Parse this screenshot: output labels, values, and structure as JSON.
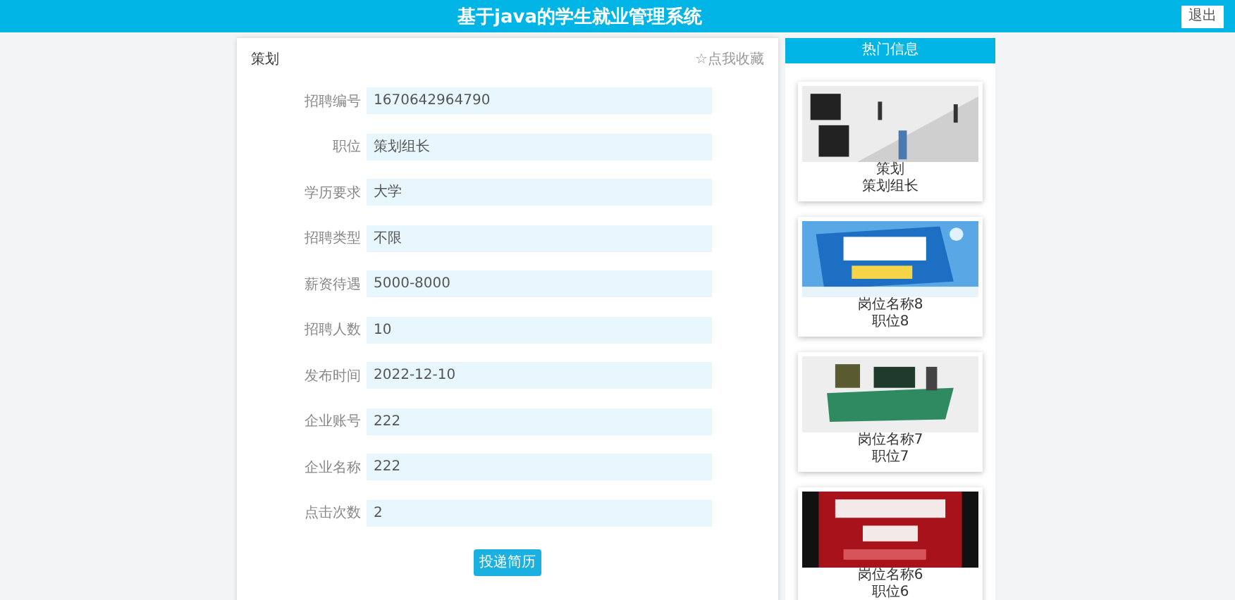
{
  "header": {
    "title": "基于java的学生就业管理系统",
    "logout": "退出"
  },
  "detail": {
    "title": "策划",
    "favorite": "☆点我收藏",
    "fields": [
      {
        "label": "招聘编号",
        "value": "1670642964790"
      },
      {
        "label": "职位",
        "value": "策划组长"
      },
      {
        "label": "学历要求",
        "value": "大学"
      },
      {
        "label": "招聘类型",
        "value": "不限"
      },
      {
        "label": "薪资待遇",
        "value": "5000-8000"
      },
      {
        "label": "招聘人数",
        "value": "10"
      },
      {
        "label": "发布时间",
        "value": "2022-12-10"
      },
      {
        "label": "企业账号",
        "value": "222"
      },
      {
        "label": "企业名称",
        "value": "222"
      },
      {
        "label": "点击次数",
        "value": "2"
      }
    ],
    "submit": "投递简历"
  },
  "sidebar": {
    "title": "热门信息",
    "cards": [
      {
        "title": "策划",
        "subtitle": "策划组长"
      },
      {
        "title": "岗位名称8",
        "subtitle": "职位8"
      },
      {
        "title": "岗位名称7",
        "subtitle": "职位7"
      },
      {
        "title": "岗位名称6",
        "subtitle": "职位6"
      }
    ]
  }
}
